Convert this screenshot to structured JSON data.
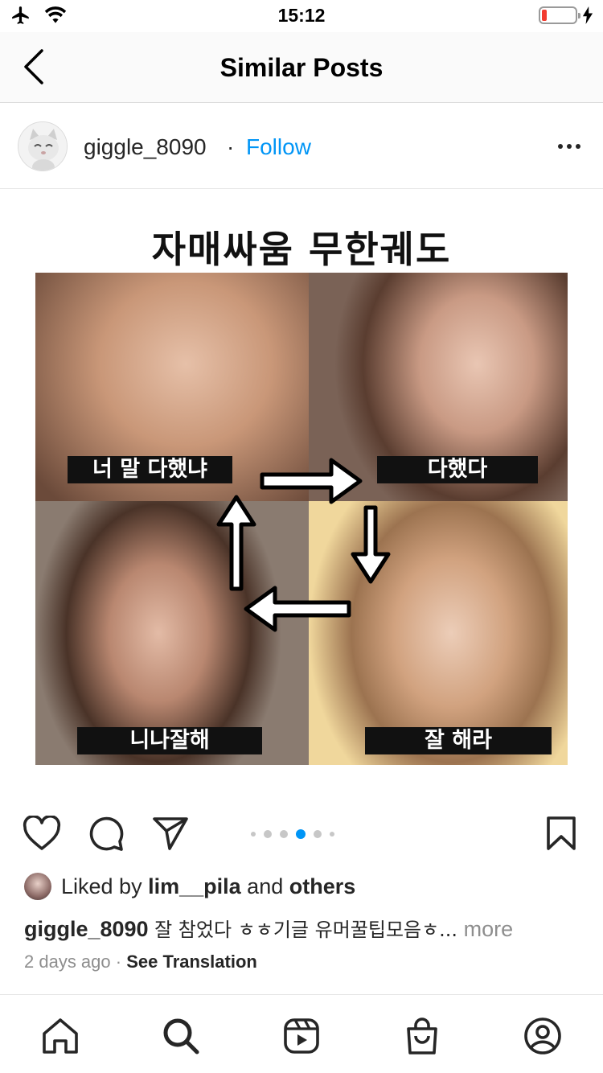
{
  "status_bar": {
    "time": "15:12",
    "battery_percent": 15
  },
  "header": {
    "title": "Similar Posts"
  },
  "post": {
    "username": "giggle_8090",
    "separator": "·",
    "follow_label": "Follow",
    "image": {
      "title": "자매싸움 무한궤도",
      "captions": [
        "너 말 다했냐",
        "다했다",
        "니나잘해",
        "잘 해라"
      ]
    },
    "pager": {
      "count": 6,
      "active_index": 3
    },
    "likes": {
      "prefix": "Liked by",
      "user": "lim__pila",
      "joiner": "and",
      "others": "others"
    },
    "caption": {
      "username": "giggle_8090",
      "text": "잘 참었다 ㅎㅎ기글 유머꿀팁모음ㅎ...",
      "more_label": "more"
    },
    "meta": {
      "time_ago": "2 days ago",
      "separator": "·",
      "translate_label": "See Translation"
    }
  },
  "colors": {
    "accent": "#0095f6",
    "text": "#262626",
    "muted": "#8e8e8e",
    "battery_low": "#f23b2f"
  },
  "icons": [
    "airplane-icon",
    "wifi-icon",
    "battery-icon",
    "charging-icon",
    "back-icon",
    "more-icon",
    "heart-icon",
    "comment-icon",
    "share-icon",
    "bookmark-icon",
    "home-icon",
    "search-icon",
    "reels-icon",
    "shop-icon",
    "profile-icon"
  ]
}
